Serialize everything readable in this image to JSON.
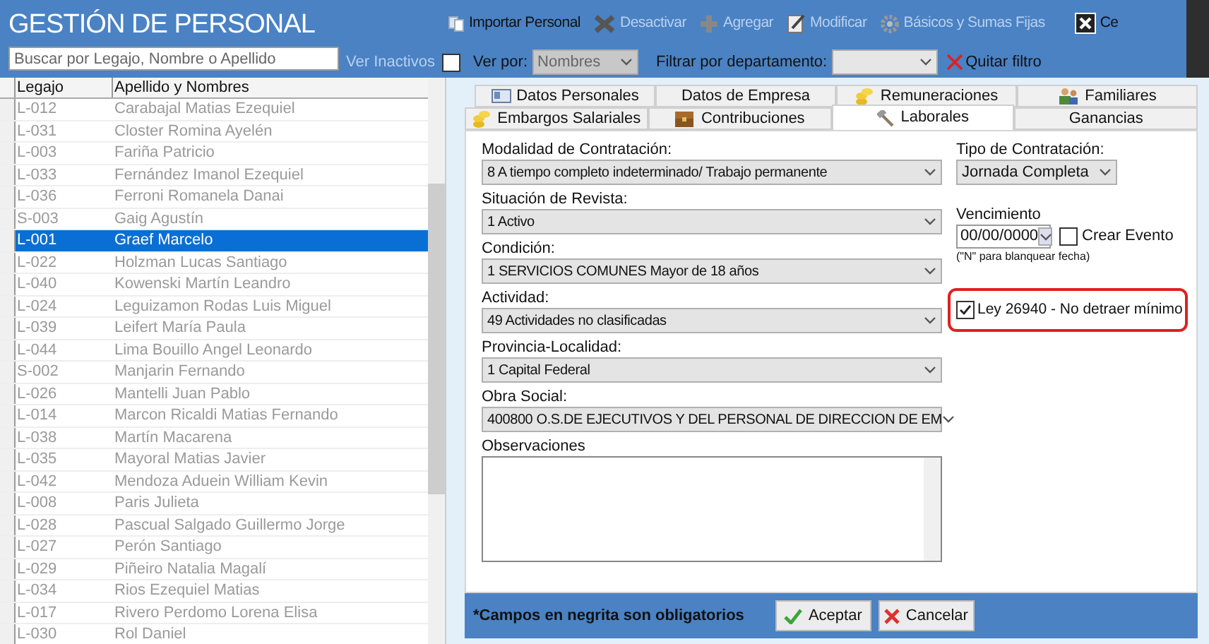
{
  "header": {
    "title": "GESTIÓN DE PERSONAL",
    "search": {
      "placeholder": "Buscar por Legajo, Nombre o Apellido"
    },
    "ver_inactivos": {
      "label": "Ver Inactivos",
      "checked": false
    },
    "ver_por": {
      "label": "Ver por:",
      "value": "Nombres"
    },
    "filtro": {
      "label": "Filtrar por departamento:"
    },
    "quitar_filtro": "Quitar filtro"
  },
  "toolbar": [
    {
      "kind": "import",
      "label": "Importar Personal",
      "disabled": false
    },
    {
      "kind": "deactivate",
      "label": "Desactivar",
      "disabled": true
    },
    {
      "kind": "add",
      "label": "Agregar",
      "disabled": true
    },
    {
      "kind": "edit",
      "label": "Modificar",
      "disabled": true
    },
    {
      "kind": "gear",
      "label": "Básicos y Sumas Fijas",
      "disabled": true
    },
    {
      "kind": "close",
      "label": "Ce",
      "disabled": false
    }
  ],
  "table": {
    "columns": [
      "Legajo",
      "Apellido y Nombres"
    ],
    "rows": [
      {
        "legajo": "L-012",
        "nombre": "Carabajal Matias Ezequiel",
        "selected": false
      },
      {
        "legajo": "L-031",
        "nombre": "Closter Romina Ayelén",
        "selected": false
      },
      {
        "legajo": "L-003",
        "nombre": "Fariña Patricio",
        "selected": false
      },
      {
        "legajo": "L-033",
        "nombre": "Fernández Imanol Ezequiel",
        "selected": false
      },
      {
        "legajo": "L-036",
        "nombre": "Ferroni Romanela Danai",
        "selected": false
      },
      {
        "legajo": "S-003",
        "nombre": "Gaig Agustín",
        "selected": false
      },
      {
        "legajo": "L-001",
        "nombre": "Graef Marcelo",
        "selected": true
      },
      {
        "legajo": "L-022",
        "nombre": "Holzman Lucas Santiago",
        "selected": false
      },
      {
        "legajo": "L-040",
        "nombre": "Kowenski Martín Leandro",
        "selected": false
      },
      {
        "legajo": "L-024",
        "nombre": "Leguizamon Rodas Luis Miguel",
        "selected": false
      },
      {
        "legajo": "L-039",
        "nombre": "Leifert María Paula",
        "selected": false
      },
      {
        "legajo": "L-044",
        "nombre": "Lima Bouillo Angel Leonardo",
        "selected": false
      },
      {
        "legajo": "S-002",
        "nombre": "Manjarin Fernando",
        "selected": false
      },
      {
        "legajo": "L-026",
        "nombre": "Mantelli Juan Pablo",
        "selected": false
      },
      {
        "legajo": "L-014",
        "nombre": "Marcon Ricaldi Matias Fernando",
        "selected": false
      },
      {
        "legajo": "L-038",
        "nombre": "Martín Macarena",
        "selected": false
      },
      {
        "legajo": "L-035",
        "nombre": "Mayoral Matias Javier",
        "selected": false
      },
      {
        "legajo": "L-042",
        "nombre": "Mendoza Aduein William Kevin",
        "selected": false
      },
      {
        "legajo": "L-008",
        "nombre": "Paris Julieta",
        "selected": false
      },
      {
        "legajo": "L-028",
        "nombre": "Pascual Salgado Guillermo Jorge",
        "selected": false
      },
      {
        "legajo": "L-027",
        "nombre": "Perón Santiago",
        "selected": false
      },
      {
        "legajo": "L-029",
        "nombre": "Piñeiro Natalia Magalí",
        "selected": false
      },
      {
        "legajo": "L-034",
        "nombre": "Rios Ezequiel Matias",
        "selected": false
      },
      {
        "legajo": "L-017",
        "nombre": "Rivero Perdomo Lorena Elisa",
        "selected": false
      },
      {
        "legajo": "L-030",
        "nombre": "Rol Daniel",
        "selected": false
      }
    ]
  },
  "tabs": [
    [
      {
        "label": "Datos Personales",
        "selected": false
      },
      {
        "label": "Datos de Empresa",
        "selected": false
      },
      {
        "label": "Remuneraciones",
        "selected": false
      },
      {
        "label": "Familiares",
        "selected": false
      }
    ],
    [
      {
        "label": "Embargos Salariales",
        "selected": false
      },
      {
        "label": "Contribuciones",
        "selected": false
      },
      {
        "label": "Laborales",
        "selected": true
      },
      {
        "label": "Ganancias",
        "selected": false
      }
    ]
  ],
  "form": {
    "fields": [
      {
        "label": "Modalidad de Contratación:",
        "value": "8 A tiempo completo indeterminado/ Trabajo permanente"
      },
      {
        "label": "Situación de Revista:",
        "value": "1 Activo"
      },
      {
        "label": "Condición:",
        "value": "1 SERVICIOS COMUNES Mayor de 18 años"
      },
      {
        "label": "Actividad:",
        "value": "49 Actividades no clasificadas"
      },
      {
        "label": "Provincia-Localidad:",
        "value": "1 Capital Federal"
      },
      {
        "label": "Obra Social:",
        "value": "400800 O.S.DE EJECUTIVOS Y DEL PERSONAL DE DIRECCION DE EM"
      }
    ],
    "observaciones": {
      "label": "Observaciones"
    },
    "tipo": {
      "label": "Tipo de Contratación:",
      "value": "Jornada Completa"
    },
    "vencimiento": {
      "label": "Vencimiento",
      "value": "00/00/0000",
      "hint": "(\"N\" para blanquear fecha)"
    },
    "crear_evento": {
      "label": "Crear Evento",
      "checked": false
    },
    "ley": {
      "label": "Ley 26940 - No detraer mínimo",
      "checked": true,
      "highlighted": true
    }
  },
  "footer": {
    "note": "*Campos en negrita son obligatorios",
    "buttons": [
      {
        "kind": "ok",
        "label": "Aceptar"
      },
      {
        "kind": "cancel",
        "label": "Cancelar"
      }
    ]
  }
}
